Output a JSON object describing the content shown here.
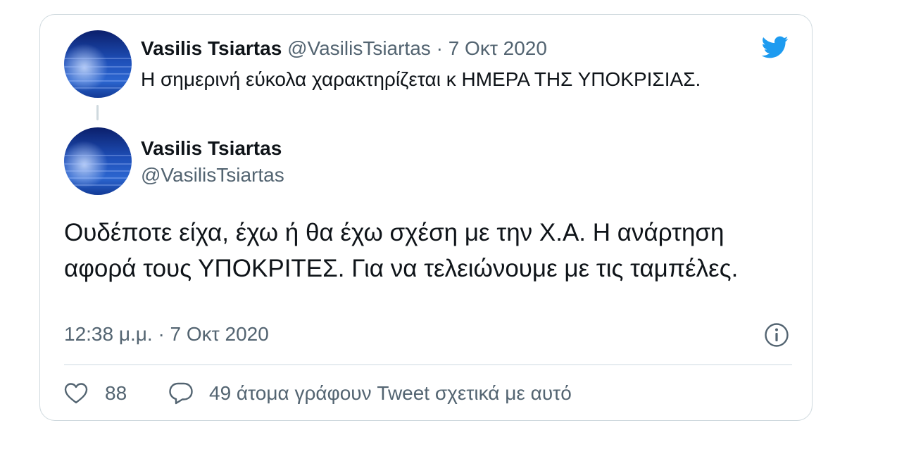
{
  "colors": {
    "brand_blue": "#1d9bf0",
    "text": "#0f1419",
    "muted": "#536471",
    "border": "#cfd9de"
  },
  "icons": {
    "brand": "twitter-bird-icon",
    "info": "info-icon",
    "like": "heart-icon",
    "reply": "speech-bubble-icon"
  },
  "parent_tweet": {
    "author_name": "Vasilis Tsiartas",
    "author_handle": "@VasilisTsiartas",
    "separator": "·",
    "date": "7 Οκτ 2020",
    "text": "Η σημερινή εύκολα χαρακτηρίζεται κ ΗΜΕΡΑ ΤΗΣ ΥΠΟΚΡΙΣΙΑΣ."
  },
  "main_tweet": {
    "author_name": "Vasilis Tsiartas",
    "author_handle": "@VasilisTsiartas",
    "text": "Ουδέποτε είχα, έχω ή θα έχω σχέση με την Χ.Α. Η ανάρτηση αφορά τους ΥΠΟΚΡΙΤΕΣ. Για να τελειώνουμε με τις ταμπέλες.",
    "timestamp": "12:38 μ.μ. · 7 Οκτ 2020"
  },
  "actions": {
    "like_count": "88",
    "reply_text": "49 άτομα γράφουν Tweet σχετικά με αυτό"
  }
}
